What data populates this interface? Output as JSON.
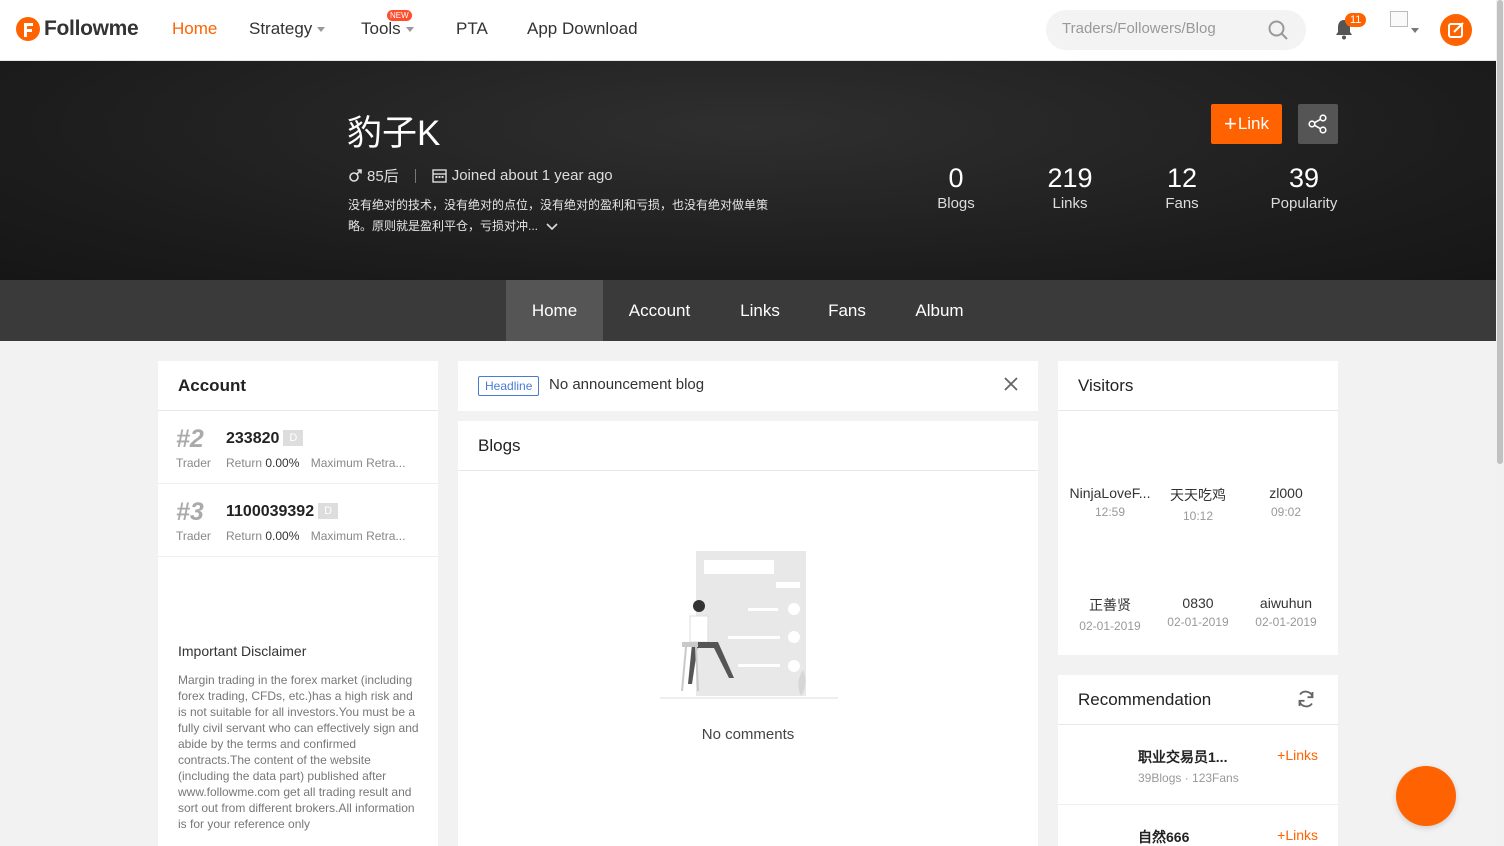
{
  "nav": {
    "brand": "Followme",
    "items": [
      {
        "label": "Home",
        "active": true
      },
      {
        "label": "Strategy"
      },
      {
        "label": "Tools",
        "badge": "NEW"
      },
      {
        "label": "PTA"
      },
      {
        "label": "App Download"
      }
    ],
    "search_placeholder": "Traders/Followers/Blog",
    "notification_count": "11",
    "accent": "#ff6200"
  },
  "profile": {
    "name": "豹子K",
    "gender_age": "85后",
    "joined": "Joined about 1 year ago",
    "bio": "没有绝对的技术，没有绝对的点位，没有绝对的盈利和亏损，也没有绝对做单策略。原则就是盈利平仓，亏损对冲...",
    "link_button": "Link",
    "stats": [
      {
        "value": "0",
        "label": "Blogs"
      },
      {
        "value": "219",
        "label": "Links"
      },
      {
        "value": "12",
        "label": "Fans"
      },
      {
        "value": "39",
        "label": "Popularity"
      }
    ]
  },
  "tabs": [
    {
      "label": "Home",
      "active": true
    },
    {
      "label": "Account"
    },
    {
      "label": "Links"
    },
    {
      "label": "Fans"
    },
    {
      "label": "Album"
    }
  ],
  "account": {
    "title": "Account",
    "rows": [
      {
        "rank": "#2",
        "role": "Trader",
        "id": "233820",
        "badge": "D",
        "return_label": "Return",
        "return_value": "0.00%",
        "drawdown_label": "Maximum Retra..."
      },
      {
        "rank": "#3",
        "role": "Trader",
        "id": "1100039392",
        "badge": "D",
        "return_label": "Return",
        "return_value": "0.00%",
        "drawdown_label": "Maximum Retra..."
      }
    ],
    "disclaimer_title": "Important Disclaimer",
    "disclaimer_body": "Margin trading in the forex market (including forex trading, CFDs, etc.)has a high risk and is not suitable for all investors.You must be a fully civil servant who can effectively sign and abide by the terms and confirmed contracts.The content of the website (including the data part) published after www.followme.com get all trading result and sort out from different brokers.All information is for your reference only"
  },
  "announcement": {
    "tag": "Headline",
    "text": "No announcement blog"
  },
  "blogs": {
    "title": "Blogs",
    "empty_text": "No comments"
  },
  "visitors": {
    "title": "Visitors",
    "items": [
      {
        "name": "NinjaLoveF...",
        "time": "12:59"
      },
      {
        "name": "天天吃鸡",
        "time": "10:12"
      },
      {
        "name": "zl000",
        "time": "09:02"
      },
      {
        "name": "正善贤",
        "time": "02-01-2019"
      },
      {
        "name": "0830",
        "time": "02-01-2019"
      },
      {
        "name": "aiwuhun",
        "time": "02-01-2019"
      }
    ]
  },
  "recommendation": {
    "title": "Recommendation",
    "items": [
      {
        "name": "职业交易员1...",
        "sub": "39Blogs · 123Fans",
        "action": "Links"
      },
      {
        "name": "自然666",
        "sub": "",
        "action": "Links"
      }
    ]
  }
}
